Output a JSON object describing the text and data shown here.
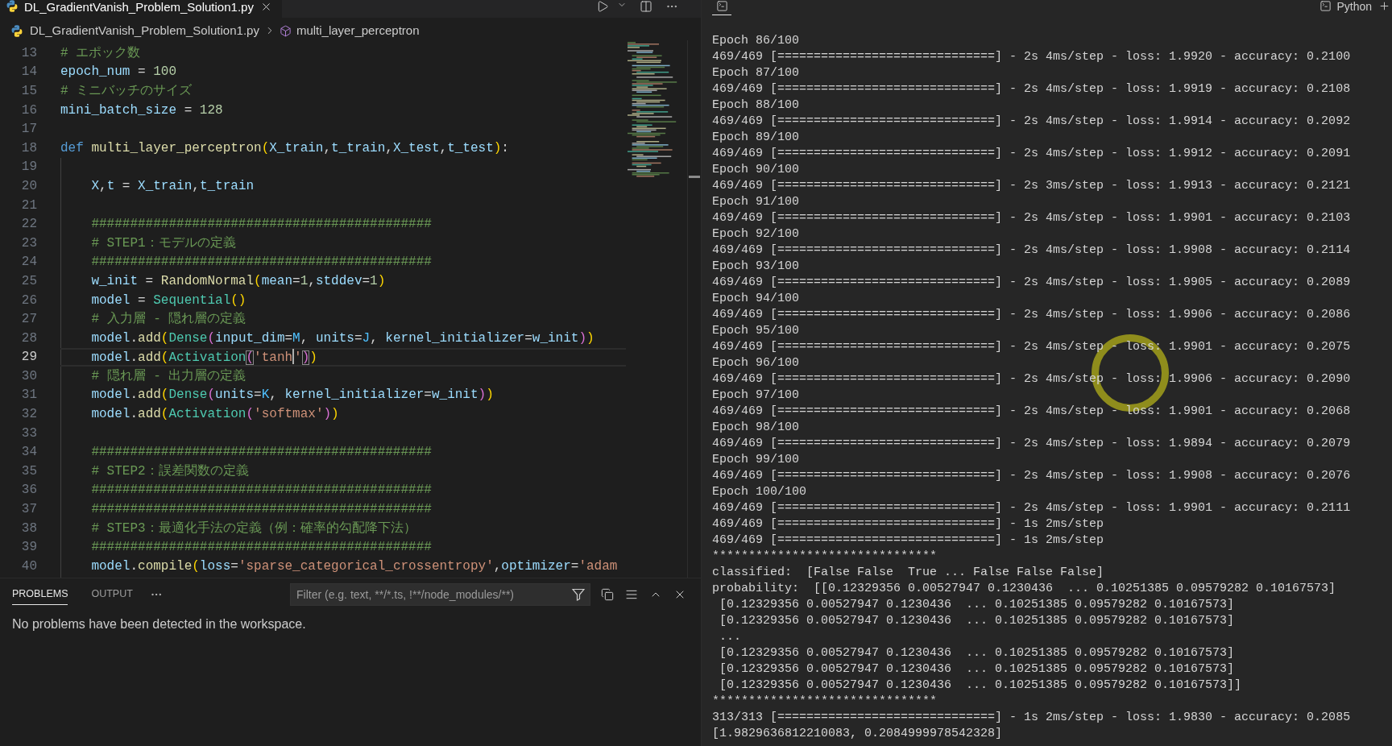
{
  "editor_tab": {
    "title": "DL_GradientVanish_Problem_Solution1.py"
  },
  "breadcrumb": {
    "file": "DL_GradientVanish_Problem_Solution1.py",
    "symbol": "multi_layer_perceptron"
  },
  "code_lines": [
    {
      "number": "13",
      "active": false,
      "tokens": [
        {
          "text": "# エポック数",
          "kind": "comment"
        }
      ]
    },
    {
      "number": "14",
      "active": false,
      "tokens": [
        {
          "text": "epoch_num",
          "kind": "variable"
        },
        {
          "text": " = ",
          "kind": "plain"
        },
        {
          "text": "100",
          "kind": "number"
        }
      ]
    },
    {
      "number": "15",
      "active": false,
      "tokens": [
        {
          "text": "# ミニバッチのサイズ",
          "kind": "comment"
        }
      ]
    },
    {
      "number": "16",
      "active": false,
      "tokens": [
        {
          "text": "mini_batch_size",
          "kind": "variable"
        },
        {
          "text": " = ",
          "kind": "plain"
        },
        {
          "text": "128",
          "kind": "number"
        }
      ]
    },
    {
      "number": "17",
      "active": false
    },
    {
      "number": "18",
      "active": false,
      "tokens": [
        {
          "text": "def ",
          "kind": "keyword"
        },
        {
          "text": "multi_layer_perceptron",
          "kind": "function"
        },
        {
          "text": "(",
          "kind": "bracket1"
        },
        {
          "text": "X_train",
          "kind": "variable"
        },
        {
          "text": ",",
          "kind": "plain"
        },
        {
          "text": "t_train",
          "kind": "variable"
        },
        {
          "text": ",",
          "kind": "plain"
        },
        {
          "text": "X_test",
          "kind": "variable"
        },
        {
          "text": ",",
          "kind": "plain"
        },
        {
          "text": "t_test",
          "kind": "variable"
        },
        {
          "text": ")",
          "kind": "bracket1"
        },
        {
          "text": ":",
          "kind": "plain"
        }
      ]
    },
    {
      "number": "19",
      "active": false
    },
    {
      "number": "20",
      "active": false,
      "tokens": [
        {
          "text": "    X",
          "kind": "variable"
        },
        {
          "text": ",",
          "kind": "plain"
        },
        {
          "text": "t",
          "kind": "variable"
        },
        {
          "text": " = ",
          "kind": "plain"
        },
        {
          "text": "X_train",
          "kind": "variable"
        },
        {
          "text": ",",
          "kind": "plain"
        },
        {
          "text": "t_train",
          "kind": "variable"
        }
      ]
    },
    {
      "number": "21",
      "active": false
    },
    {
      "number": "22",
      "active": false,
      "tokens": [
        {
          "text": "    ############################################",
          "kind": "comment"
        }
      ]
    },
    {
      "number": "23",
      "active": false,
      "tokens": [
        {
          "text": "    # STEP1：モデルの定義",
          "kind": "comment"
        }
      ]
    },
    {
      "number": "24",
      "active": false,
      "tokens": [
        {
          "text": "    ############################################",
          "kind": "comment"
        }
      ]
    },
    {
      "number": "25",
      "active": false,
      "tokens": [
        {
          "text": "    w_init",
          "kind": "variable"
        },
        {
          "text": " = ",
          "kind": "plain"
        },
        {
          "text": "RandomNormal",
          "kind": "function"
        },
        {
          "text": "(",
          "kind": "bracket1"
        },
        {
          "text": "mean",
          "kind": "variable"
        },
        {
          "text": "=",
          "kind": "plain"
        },
        {
          "text": "1",
          "kind": "number"
        },
        {
          "text": ",",
          "kind": "plain"
        },
        {
          "text": "stddev",
          "kind": "variable"
        },
        {
          "text": "=",
          "kind": "plain"
        },
        {
          "text": "1",
          "kind": "number"
        },
        {
          "text": ")",
          "kind": "bracket1"
        }
      ]
    },
    {
      "number": "26",
      "active": false,
      "tokens": [
        {
          "text": "    model",
          "kind": "variable"
        },
        {
          "text": " = ",
          "kind": "plain"
        },
        {
          "text": "Sequential",
          "kind": "class"
        },
        {
          "text": "()",
          "kind": "bracket1"
        }
      ]
    },
    {
      "number": "27",
      "active": false,
      "tokens": [
        {
          "text": "    # 入力層 - 隠れ層の定義",
          "kind": "comment"
        }
      ]
    },
    {
      "number": "28",
      "active": false,
      "tokens": [
        {
          "text": "    model",
          "kind": "variable"
        },
        {
          "text": ".",
          "kind": "plain"
        },
        {
          "text": "add",
          "kind": "function"
        },
        {
          "text": "(",
          "kind": "bracket1"
        },
        {
          "text": "Dense",
          "kind": "class"
        },
        {
          "text": "(",
          "kind": "bracket2"
        },
        {
          "text": "input_dim",
          "kind": "variable"
        },
        {
          "text": "=",
          "kind": "plain"
        },
        {
          "text": "M",
          "kind": "constant"
        },
        {
          "text": ", ",
          "kind": "plain"
        },
        {
          "text": "units",
          "kind": "variable"
        },
        {
          "text": "=",
          "kind": "plain"
        },
        {
          "text": "J",
          "kind": "constant"
        },
        {
          "text": ", ",
          "kind": "plain"
        },
        {
          "text": "kernel_initializer",
          "kind": "variable"
        },
        {
          "text": "=",
          "kind": "plain"
        },
        {
          "text": "w_init",
          "kind": "variable"
        },
        {
          "text": ")",
          "kind": "bracket2"
        },
        {
          "text": ")",
          "kind": "bracket1"
        }
      ]
    },
    {
      "number": "29",
      "active": true,
      "tokens": [
        {
          "text": "    model",
          "kind": "variable"
        },
        {
          "text": ".",
          "kind": "plain"
        },
        {
          "text": "add",
          "kind": "function"
        },
        {
          "text": "(",
          "kind": "bracket1"
        },
        {
          "text": "Activation",
          "kind": "class"
        },
        {
          "text": "(",
          "kind": "bracket-match"
        },
        {
          "text": "'tanh",
          "kind": "string"
        },
        {
          "kind": "cursor"
        },
        {
          "text": "'",
          "kind": "string"
        },
        {
          "text": ")",
          "kind": "bracket-match"
        },
        {
          "text": ")",
          "kind": "bracket1"
        }
      ]
    },
    {
      "number": "30",
      "active": false,
      "tokens": [
        {
          "text": "    # 隠れ層 - 出力層の定義",
          "kind": "comment"
        }
      ]
    },
    {
      "number": "31",
      "active": false,
      "tokens": [
        {
          "text": "    model",
          "kind": "variable"
        },
        {
          "text": ".",
          "kind": "plain"
        },
        {
          "text": "add",
          "kind": "function"
        },
        {
          "text": "(",
          "kind": "bracket1"
        },
        {
          "text": "Dense",
          "kind": "class"
        },
        {
          "text": "(",
          "kind": "bracket2"
        },
        {
          "text": "units",
          "kind": "variable"
        },
        {
          "text": "=",
          "kind": "plain"
        },
        {
          "text": "K",
          "kind": "constant"
        },
        {
          "text": ", ",
          "kind": "plain"
        },
        {
          "text": "kernel_initializer",
          "kind": "variable"
        },
        {
          "text": "=",
          "kind": "plain"
        },
        {
          "text": "w_init",
          "kind": "variable"
        },
        {
          "text": ")",
          "kind": "bracket2"
        },
        {
          "text": ")",
          "kind": "bracket1"
        }
      ]
    },
    {
      "number": "32",
      "active": false,
      "tokens": [
        {
          "text": "    model",
          "kind": "variable"
        },
        {
          "text": ".",
          "kind": "plain"
        },
        {
          "text": "add",
          "kind": "function"
        },
        {
          "text": "(",
          "kind": "bracket1"
        },
        {
          "text": "Activation",
          "kind": "class"
        },
        {
          "text": "(",
          "kind": "bracket2"
        },
        {
          "text": "'softmax'",
          "kind": "string"
        },
        {
          "text": ")",
          "kind": "bracket2"
        },
        {
          "text": ")",
          "kind": "bracket1"
        }
      ]
    },
    {
      "number": "33",
      "active": false
    },
    {
      "number": "34",
      "active": false,
      "tokens": [
        {
          "text": "    ############################################",
          "kind": "comment"
        }
      ]
    },
    {
      "number": "35",
      "active": false,
      "tokens": [
        {
          "text": "    # STEP2：誤差関数の定義",
          "kind": "comment"
        }
      ]
    },
    {
      "number": "36",
      "active": false,
      "tokens": [
        {
          "text": "    ############################################",
          "kind": "comment"
        }
      ]
    },
    {
      "number": "37",
      "active": false,
      "tokens": [
        {
          "text": "    ############################################",
          "kind": "comment"
        }
      ]
    },
    {
      "number": "38",
      "active": false,
      "tokens": [
        {
          "text": "    # STEP3：最適化手法の定義（例：確率的勾配降下法）",
          "kind": "comment"
        }
      ]
    },
    {
      "number": "39",
      "active": false,
      "tokens": [
        {
          "text": "    ############################################",
          "kind": "comment"
        }
      ]
    },
    {
      "number": "40",
      "active": false,
      "tokens": [
        {
          "text": "    model",
          "kind": "variable"
        },
        {
          "text": ".",
          "kind": "plain"
        },
        {
          "text": "compile",
          "kind": "function"
        },
        {
          "text": "(",
          "kind": "bracket1"
        },
        {
          "text": "loss",
          "kind": "variable"
        },
        {
          "text": "=",
          "kind": "plain"
        },
        {
          "text": "'sparse_categorical_crossentropy'",
          "kind": "string"
        },
        {
          "text": ",",
          "kind": "plain"
        },
        {
          "text": "optimizer",
          "kind": "variable"
        },
        {
          "text": "=",
          "kind": "plain"
        },
        {
          "text": "'adam",
          "kind": "string"
        }
      ]
    }
  ],
  "panel": {
    "tabs": [
      {
        "label": "PROBLEMS",
        "selected": true
      },
      {
        "label": "OUTPUT",
        "selected": false
      }
    ],
    "filter": {
      "placeholder": "Filter (e.g. text, **/*.ts, !**/node_modules/**)"
    },
    "message": "No problems have been detected in the workspace."
  },
  "terminal": {
    "shell": "Python",
    "lines": [
      "Epoch 86/100",
      "469/469 [==============================] - 2s 4ms/step - loss: 1.9920 - accuracy: 0.2100",
      "Epoch 87/100",
      "469/469 [==============================] - 2s 4ms/step - loss: 1.9919 - accuracy: 0.2108",
      "Epoch 88/100",
      "469/469 [==============================] - 2s 4ms/step - loss: 1.9914 - accuracy: 0.2092",
      "Epoch 89/100",
      "469/469 [==============================] - 2s 4ms/step - loss: 1.9912 - accuracy: 0.2091",
      "Epoch 90/100",
      "469/469 [==============================] - 2s 3ms/step - loss: 1.9913 - accuracy: 0.2121",
      "Epoch 91/100",
      "469/469 [==============================] - 2s 4ms/step - loss: 1.9901 - accuracy: 0.2103",
      "Epoch 92/100",
      "469/469 [==============================] - 2s 4ms/step - loss: 1.9908 - accuracy: 0.2114",
      "Epoch 93/100",
      "469/469 [==============================] - 2s 4ms/step - loss: 1.9905 - accuracy: 0.2089",
      "Epoch 94/100",
      "469/469 [==============================] - 2s 4ms/step - loss: 1.9906 - accuracy: 0.2086",
      "Epoch 95/100",
      "469/469 [==============================] - 2s 4ms/step - loss: 1.9901 - accuracy: 0.2075",
      "Epoch 96/100",
      "469/469 [==============================] - 2s 4ms/step - loss: 1.9906 - accuracy: 0.2090",
      "Epoch 97/100",
      "469/469 [==============================] - 2s 4ms/step - loss: 1.9901 - accuracy: 0.2068",
      "Epoch 98/100",
      "469/469 [==============================] - 2s 4ms/step - loss: 1.9894 - accuracy: 0.2079",
      "Epoch 99/100",
      "469/469 [==============================] - 2s 4ms/step - loss: 1.9908 - accuracy: 0.2076",
      "Epoch 100/100",
      "469/469 [==============================] - 2s 4ms/step - loss: 1.9901 - accuracy: 0.2111",
      "469/469 [==============================] - 1s 2ms/step",
      "469/469 [==============================] - 1s 2ms/step",
      "*******************************",
      "classified:  [False False  True ... False False False]",
      "probability:  [[0.12329356 0.00527947 0.1230436  ... 0.10251385 0.09579282 0.10167573]",
      " [0.12329356 0.00527947 0.1230436  ... 0.10251385 0.09579282 0.10167573]",
      " [0.12329356 0.00527947 0.1230436  ... 0.10251385 0.09579282 0.10167573]",
      " ...",
      " [0.12329356 0.00527947 0.1230436  ... 0.10251385 0.09579282 0.10167573]",
      " [0.12329356 0.00527947 0.1230436  ... 0.10251385 0.09579282 0.10167573]",
      " [0.12329356 0.00527947 0.1230436  ... 0.10251385 0.09579282 0.10167573]]",
      "*******************************",
      "313/313 [==============================] - 1s 2ms/step - loss: 1.9830 - accuracy: 0.2085",
      "[1.9829636812210083, 0.2084999978542328]"
    ]
  }
}
